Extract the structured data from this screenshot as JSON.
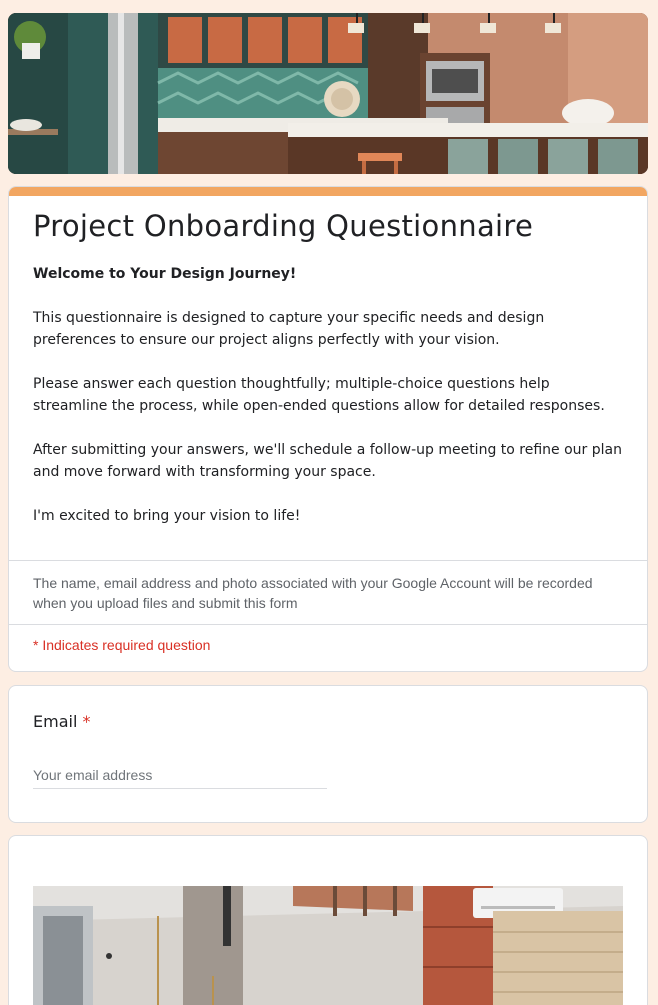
{
  "header": {
    "banner_image": "kitchen-interior-photo"
  },
  "form": {
    "title": "Project Onboarding Questionnaire",
    "description": {
      "heading": "Welcome to Your Design Journey!",
      "paragraphs": [
        "This questionnaire is designed to capture your specific needs and design preferences to ensure our project aligns perfectly with your vision.",
        "Please answer each question thoughtfully; multiple-choice questions help streamline the process, while open-ended questions allow for detailed responses.",
        "After submitting your answers, we'll schedule a follow-up meeting to refine our plan and move forward with transforming your space.",
        "I'm excited to bring your vision to life!"
      ]
    },
    "account_note": "The name, email address and photo associated with your Google Account will be recorded when you upload files and submit this form",
    "required_note": "* Indicates required question"
  },
  "email_question": {
    "label": "Email",
    "required_marker": "*",
    "placeholder": "Your email address",
    "value": ""
  },
  "image_item": {
    "image": "interior-staircase-photo"
  },
  "colors": {
    "page_background": "#fdeee3",
    "accent": "#f2a661",
    "required_red": "#d93025",
    "text": "#202124",
    "secondary_text": "#5f6368"
  }
}
